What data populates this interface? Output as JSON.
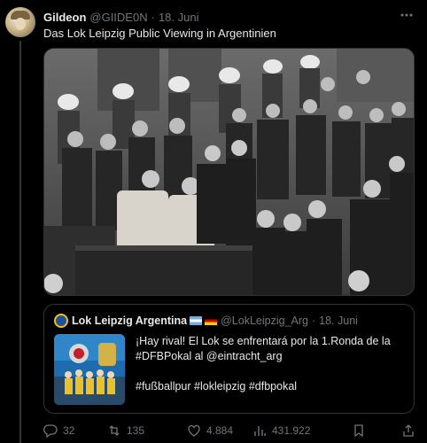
{
  "tweet": {
    "author_name": "Gildeon",
    "handle": "@GIIDE0N",
    "separator": "·",
    "date": "18. Juni",
    "text": "Das Lok Leipzig Public Viewing in Argentinien",
    "more_icon": "more-icon"
  },
  "quote": {
    "author_name": "Lok Leipzig Argentina",
    "flags": [
      "argentina-flag",
      "germany-flag"
    ],
    "handle": "@LokLeipzig_Arg",
    "separator": "·",
    "date": "18. Juni",
    "lines": [
      "¡Hay rival! El Lok se enfrentará por la 1.Ronda de la",
      "#DFBPokal al @eintracht_arg",
      "#fußballpur #lokleipzig #dfbpokal"
    ]
  },
  "actions": {
    "reply_count": "32",
    "retweet_count": "135",
    "like_count": "4.884",
    "view_count": "431.922"
  }
}
